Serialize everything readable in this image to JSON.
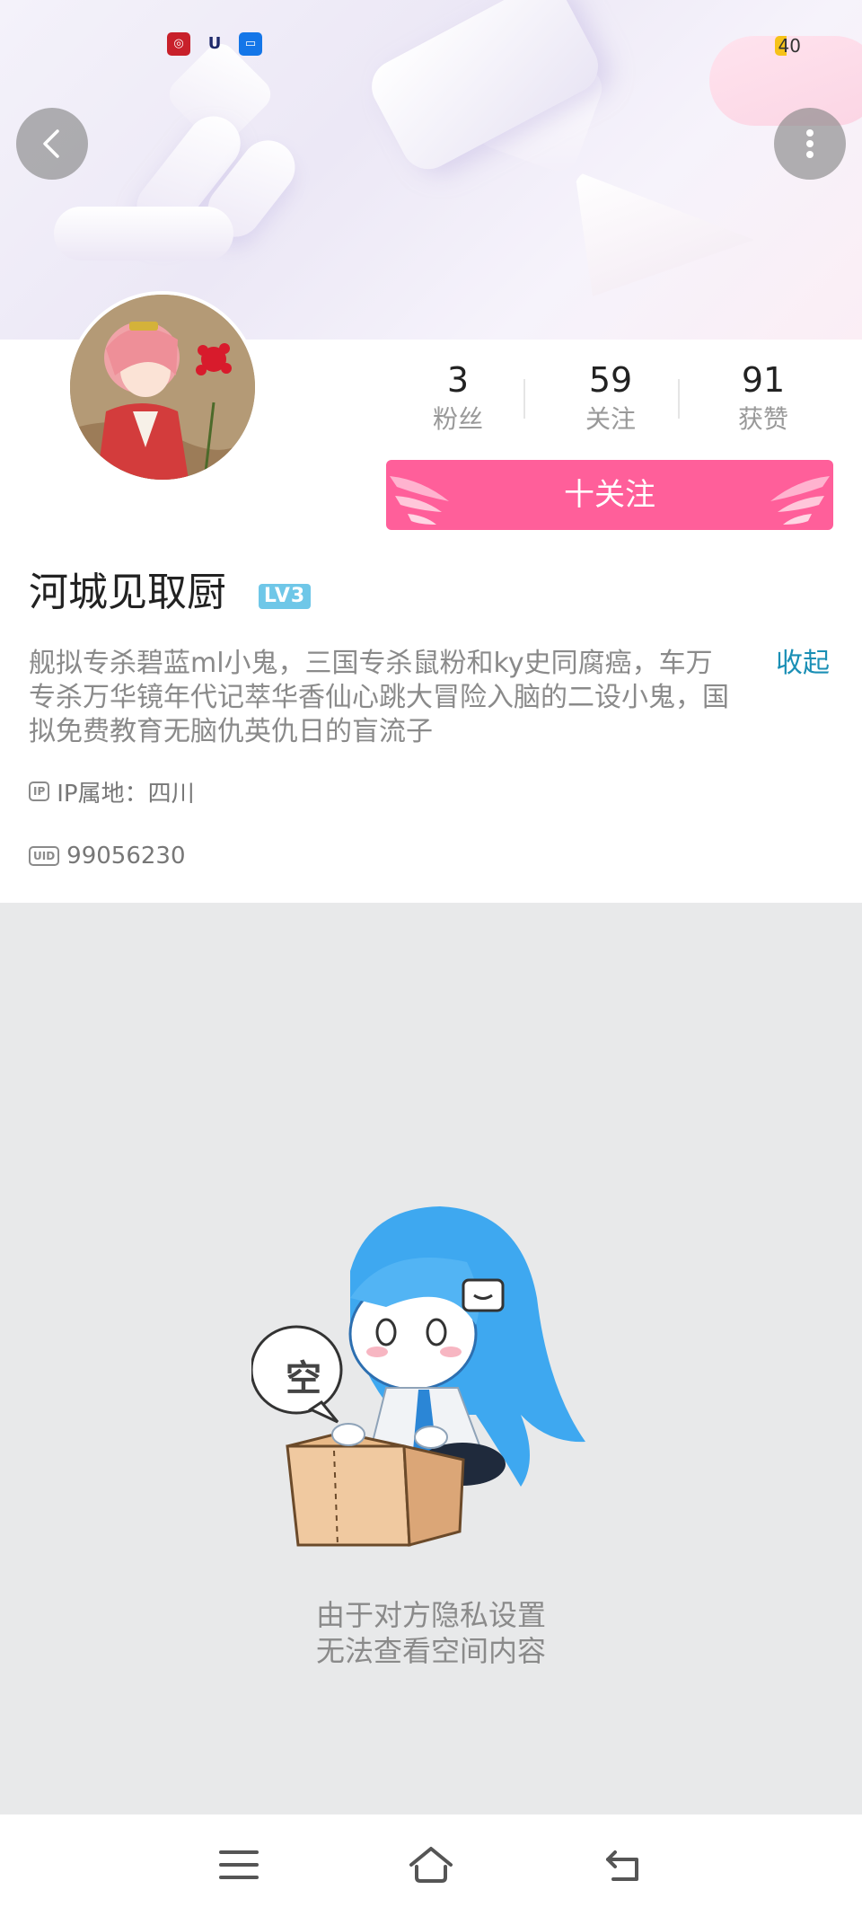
{
  "status_bar": {
    "app_icons": [
      "bank-app-icon",
      "u-app-icon",
      "bilibili-tv-app-icon"
    ],
    "app2_glyph": "U",
    "battery": "40"
  },
  "header": {
    "back_icon": "chevron-left-icon",
    "more_icon": "more-vertical-icon"
  },
  "profile": {
    "stats": [
      {
        "value": "3",
        "label": "粉丝"
      },
      {
        "value": "59",
        "label": "关注"
      },
      {
        "value": "91",
        "label": "获赞"
      }
    ],
    "follow_label": "十关注",
    "username": "河城见取厨",
    "level": "LV3",
    "bio": "舰拟专杀碧蓝ml小鬼，三国专杀鼠粉和ky史同腐癌，车万专杀万华镜年代记萃华香仙心跳大冒险入脑的二设小鬼，国拟免费教育无脑仇英仇日的盲流子",
    "collapse_label": "收起",
    "ip_tag": "IP",
    "ip_text": "IP属地：四川",
    "uid_tag": "UID",
    "uid": "99056230"
  },
  "empty_state": {
    "bubble": "空",
    "line1": "由于对方隐私设置",
    "line2": "无法查看空间内容"
  },
  "nav": {
    "icons": [
      "menu-icon",
      "home-icon",
      "back-icon"
    ]
  },
  "colors": {
    "accent_pink": "#ff5f9a",
    "link_blue": "#1a8fb5",
    "level_badge": "#6fc7e8",
    "empty_bg": "#e8e9ea"
  }
}
